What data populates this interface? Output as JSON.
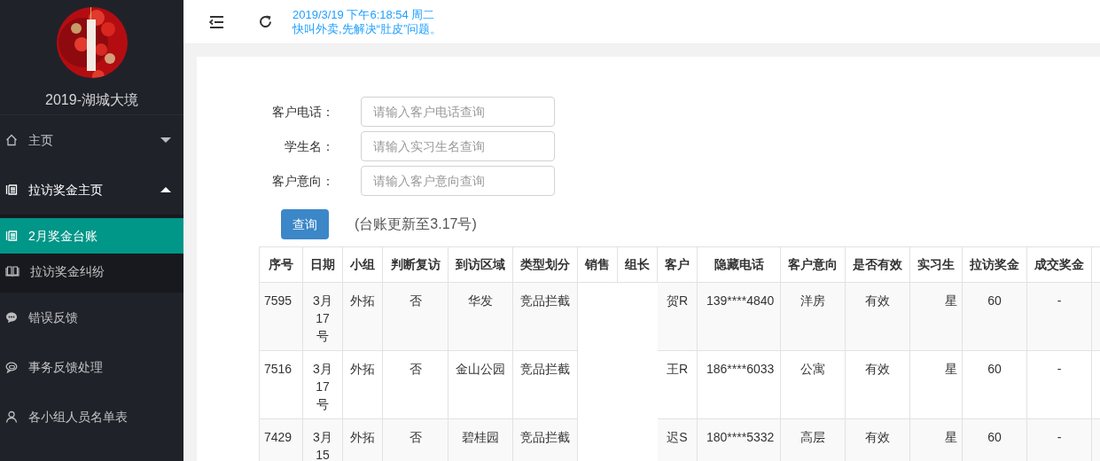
{
  "sidebar": {
    "title": "2019-湖城大境",
    "items": [
      {
        "label": "主页",
        "expanded": false
      },
      {
        "label": "拉访奖金主页",
        "expanded": true,
        "children": [
          {
            "label": "2月奖金台账",
            "selected": true
          },
          {
            "label": "拉访奖金纠纷",
            "selected": false
          }
        ]
      },
      {
        "label": "错误反馈"
      },
      {
        "label": "事务反馈处理"
      },
      {
        "label": "各小组人员名单表"
      }
    ]
  },
  "header": {
    "datetime": "2019/3/19 下午6:18:54 周二",
    "slogan": "快叫外卖,先解决“肚皮”问题。"
  },
  "search_form": {
    "fields": [
      {
        "label": "客户电话：",
        "placeholder": "请输入客户电话查询"
      },
      {
        "label": "学生名：",
        "placeholder": "请输入实习生名查询"
      },
      {
        "label": "客户意向：",
        "placeholder": "请输入客户意向查询"
      }
    ],
    "button": "查询",
    "note": "(台账更新至3.17号)"
  },
  "table": {
    "columns": [
      "序号",
      "日期",
      "小组",
      "判断复访",
      "到访区域",
      "类型划分",
      "销售",
      "组长",
      "客户",
      "隐藏电话",
      "客户意向",
      "是否有效",
      "实习生",
      "拉访奖金",
      "成交奖金"
    ],
    "rows": [
      [
        "7595",
        "3月17号",
        "外拓",
        "否",
        "华发",
        "竞品拦截",
        "",
        "",
        "贺R",
        "139****4840",
        "洋房",
        "有效",
        "星",
        "60",
        "-"
      ],
      [
        "7516",
        "3月17号",
        "外拓",
        "否",
        "金山公园",
        "竞品拦截",
        "",
        "",
        "王R",
        "186****6033",
        "公寓",
        "有效",
        "星",
        "60",
        "-"
      ],
      [
        "7429",
        "3月15",
        "外拓",
        "否",
        "碧桂园",
        "竞品拦截",
        "",
        "",
        "迟S",
        "180****5332",
        "高层",
        "有效",
        "星",
        "60",
        "-"
      ]
    ]
  }
}
